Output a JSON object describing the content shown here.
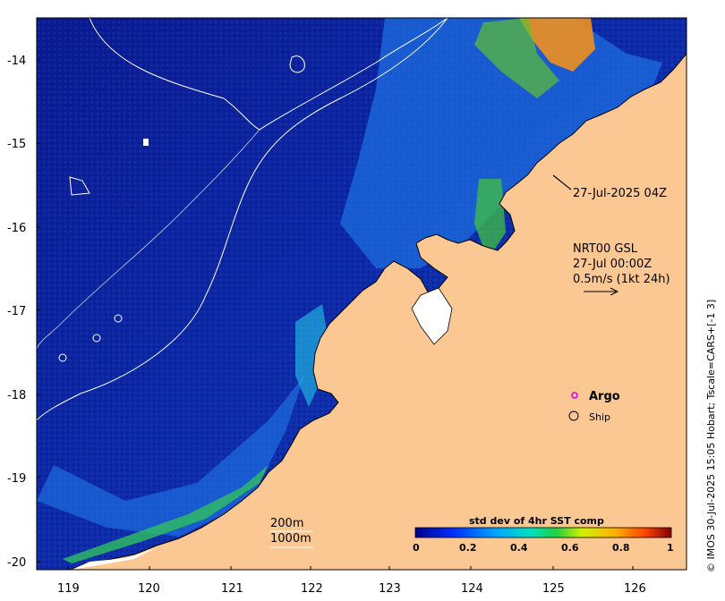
{
  "map": {
    "lon_ticks": [
      "119",
      "120",
      "121",
      "122",
      "123",
      "124",
      "125",
      "126"
    ],
    "lat_ticks": [
      "-14",
      "-15",
      "-16",
      "-17",
      "-18",
      "-19",
      "-20"
    ],
    "lon_range": [
      118.6,
      126.8
    ],
    "lat_range": [
      -20.1,
      -13.5
    ],
    "colors": {
      "land": "#fbc893",
      "ocean_deep": "#0a1a8c",
      "ocean_mid": "#1850c8",
      "ocean_shelf": "#2fa0e8",
      "contour": "#ffffff",
      "argo_marker": "#e000e0"
    }
  },
  "annotations": {
    "timestamp": "27-Jul-2025 04Z",
    "current_product": "NRT00 GSL",
    "current_time": "27-Jul 00:00Z",
    "current_scale": "0.5m/s (1kt 24h)"
  },
  "legend": {
    "argo_label": "Argo",
    "ship_label": "Ship",
    "bathy_200": "200m",
    "bathy_1000": "1000m"
  },
  "colorbar": {
    "title": "std dev of 4hr SST comp",
    "ticks": [
      "0",
      "0.2",
      "0.4",
      "0.6",
      "0.8",
      "1"
    ],
    "colors": [
      "#00008f",
      "#0040ff",
      "#00b0ff",
      "#00e060",
      "#c8ff00",
      "#ffa000",
      "#ff4000",
      "#800000"
    ]
  },
  "credit": "© IMOS 30-Jul-2025 15:05 Hobart; Tscale=CARS+[-1 3]"
}
